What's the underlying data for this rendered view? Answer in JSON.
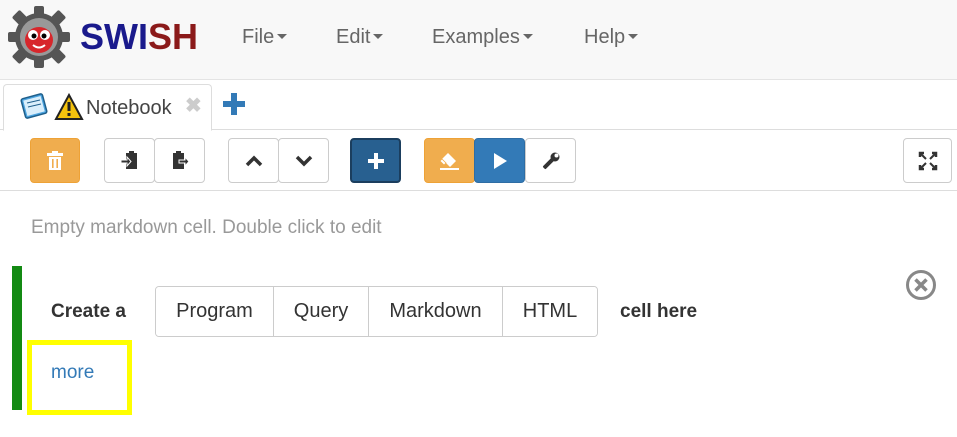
{
  "navbar": {
    "brand": {
      "part1": "SWI",
      "part2": "SH"
    },
    "menus": [
      {
        "label": "File"
      },
      {
        "label": "Edit"
      },
      {
        "label": "Examples"
      },
      {
        "label": "Help"
      }
    ]
  },
  "tabs": [
    {
      "label": "Notebook",
      "close": "✖"
    }
  ],
  "toolbar": {
    "buttons": [
      {
        "name": "delete-cell-button",
        "icon": "trash-icon",
        "style": "warning"
      },
      {
        "name": "copy-cell-button",
        "icon": "copy-icon",
        "style": "default"
      },
      {
        "name": "paste-cell-button",
        "icon": "paste-icon",
        "style": "default"
      },
      {
        "name": "move-up-button",
        "icon": "chevron-up-icon",
        "style": "default"
      },
      {
        "name": "move-down-button",
        "icon": "chevron-down-icon",
        "style": "default"
      },
      {
        "name": "insert-cell-button",
        "icon": "plus-icon",
        "style": "dark-primary"
      },
      {
        "name": "clear-output-button",
        "icon": "eraser-icon",
        "style": "warning"
      },
      {
        "name": "run-button",
        "icon": "play-icon",
        "style": "primary"
      },
      {
        "name": "settings-button",
        "icon": "wrench-icon",
        "style": "default"
      },
      {
        "name": "fullscreen-button",
        "icon": "fullscreen-icon",
        "style": "default"
      }
    ]
  },
  "notebook": {
    "empty_markdown": "Empty markdown cell. Double click to edit",
    "create_label": "Create a",
    "cell_types": [
      "Program",
      "Query",
      "Markdown",
      "HTML"
    ],
    "cell_here": "cell here",
    "more_link": "more"
  },
  "colors": {
    "accent": "#337ab7",
    "warning": "#f0ad4e",
    "cell_bar": "#138a13",
    "highlight": "#ffff00",
    "brand_blue": "#1a1a8c",
    "brand_red": "#8b1a1a"
  }
}
